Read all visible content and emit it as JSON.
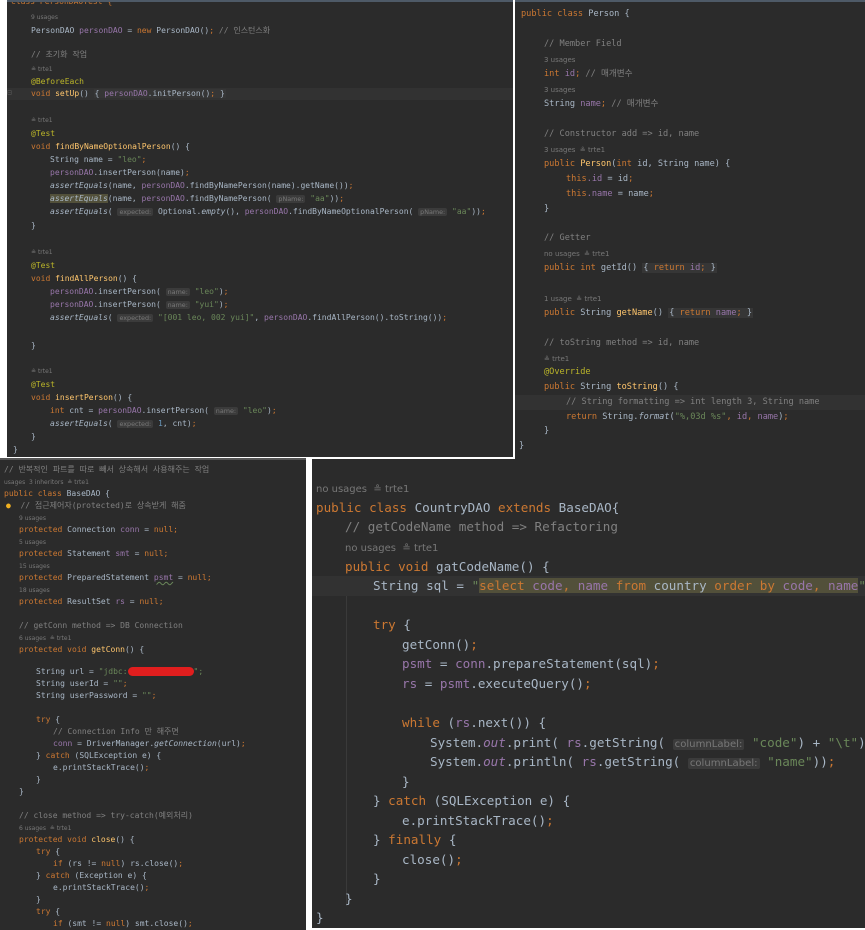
{
  "pane_top_left": {
    "title": "PersonDAOTest",
    "lines": {
      "class_decl": "class PersonDAOTest {",
      "usages_1": "9 usages",
      "field_type": "PersonDAO ",
      "field_name": "personDAO",
      "field_eq": " = ",
      "field_new": "new",
      "field_ctor": " PersonDAO()",
      "field_semi": ";",
      "field_comment": " // 인스턴스화",
      "init_comment": "// 초기화 작업",
      "author": "trte1",
      "before_each": "@BeforeEach",
      "setup_void": "void ",
      "setup_name": "setUp",
      "setup_body_open": "() ",
      "setup_brace_open": "{",
      "setup_field": "personDAO",
      "setup_call": ".initPerson()",
      "setup_semi": ";",
      "setup_brace_close": "}",
      "test_ann": "@Test",
      "m1_name": "findByNameOptionalPerson",
      "m1_l1_type": "String name = ",
      "m1_l1_str": "\"leo\"",
      "m1_l2_call": ".insertPerson(name)",
      "m1_l3_assert": "assertEquals",
      "m1_l3_rest": "(name, ",
      "m1_l3_call": ".findByNamePerson(name).getName())",
      "m1_l4_call": ".findByNamePerson( ",
      "hint_pname": "pName:",
      "str_aa": "\"aa\"",
      "hint_expected": "expected:",
      "m1_l5_optional": " Optional.",
      "m1_l5_empty": "empty",
      "m1_l5_rest": "(), ",
      "m1_l5_call": ".findByNameOptionalPerson( ",
      "m2_name": "findAllPerson",
      "insert_call": ".insertPerson( ",
      "hint_name": "name:",
      "str_leo": "\"leo\"",
      "str_yui": "\"yui\"",
      "m2_expected_str": "\"[001 leo, 002 yui]\"",
      "m2_call": ".findAllPerson().toString())",
      "m3_name": "insertPerson",
      "m3_int": "int",
      "m3_cnt": " cnt = ",
      "m3_one": " 1",
      "m3_rest": ", cnt)",
      "close_brace": "}"
    }
  },
  "pane_top_right": {
    "title": "Person",
    "lines": {
      "class_public": "public class",
      "class_name": " Person {",
      "c_member": "// Member Field",
      "usages3": "3 usages",
      "f_int": "int",
      "f_id": " id",
      "f_comment": " // 매개변수",
      "f_string": "String ",
      "f_name": "name",
      "c_ctor": "// Constructor add => id, name",
      "author": "trte1",
      "ctor_public": "public ",
      "ctor_name": "Person",
      "ctor_params_int": "int",
      "ctor_params": " id, String name) {",
      "this": "this",
      "dot_id": ".id",
      "eq_id": " = id",
      "dot_name": ".name",
      "eq_name": " = name",
      "c_getter": "// Getter",
      "no_usages": "no usages",
      "get_id_sig_public": "public int ",
      "get_id_name": "getId",
      "return_kw": "return",
      "id_word": " id",
      "usage1": "1 usage",
      "get_name_sig": "public ",
      "get_name_type": "String ",
      "get_name_name": "getName",
      "name_word": " name",
      "c_tostring": "// toString method => id, name",
      "override": "@Override",
      "tostring_name": "toString",
      "c_format": "// String formatting => int length 3, String name",
      "format_call": " String.",
      "format_fn": "format",
      "format_str": "\"%,03d %s\"",
      "format_id": "id",
      "format_name": "name",
      "close_brace": "}"
    }
  },
  "pane_bottom_left": {
    "title": "BaseDAO",
    "lines": {
      "c_top": "// 반복적인 파트를 따로 빼서 상속해서 사용해주는 작업",
      "meta_top": "usages  3 inheritors  ≗ trte1",
      "class_decl_kw": "public class",
      "class_decl_name": " BaseDAO {",
      "c_protected": "// 접근제어자(protected)로 상속받게 해줌",
      "u9": "9 usages",
      "protected": "protected",
      "conn_type": " Connection ",
      "conn_name": "conn",
      "null": "null",
      "u5": "5 usages",
      "smt_type": " Statement ",
      "smt_name": "smt",
      "u15": "15 usages",
      "psmt_type": " PreparedStatement ",
      "psmt_name": "psmt",
      "u18": "18 usages",
      "rs_type": " ResultSet ",
      "rs_name": "rs",
      "c_getconn": "// getConn method => DB Connection",
      "u6_author": "6 usages  ≗ trte1",
      "void_kw": " void ",
      "getconn_name": "getConn",
      "url_decl": "String url = ",
      "url_prefix": "\"jdbc:",
      "url_suffix": "\";",
      "userid_decl": "String userId = ",
      "empty_str": "\"\"",
      "userpw_decl": "String userPassword = ",
      "try_kw": "try",
      "c_conn_info": "// Connection Info 만 해주면",
      "conn_assign": " = DriverManager.",
      "get_connection": "getConnection",
      "url_arg": "(url)",
      "catch_kw": "catch",
      "sqlex": " (SQLException e) {",
      "print_stack": "e.printStackTrace()",
      "c_close": "// close method => try-catch(예외처리)",
      "close_name": "close",
      "if_kw": "if",
      "rs_check": " (rs != ",
      "rs_close": ") rs.close()",
      "ex": " (Exception e) {",
      "smt_check": " (smt != ",
      "smt_close": ") smt.close()"
    }
  },
  "pane_bottom_right": {
    "title": "CountryDAO",
    "lines": {
      "meta_class": "no usages",
      "author": "trte1",
      "class_kw": "public class",
      "class_name": " CountryDAO ",
      "extends_kw": "extends",
      "base_name": " BaseDAO{",
      "c_refactor": "// getCodeName method => Refactoring",
      "meta_method": "no usages",
      "method_kw": "public void",
      "method_name": " gatCodeName",
      "method_rest": "() {",
      "sql_decl": "String sql = ",
      "sql_q": "\"",
      "sql_select": "select",
      "sql_code": " code",
      "sql_comma": ",",
      "sql_name": " name",
      "sql_from": " from",
      "sql_country": " country",
      "sql_order": " order by",
      "sql_code2": " code",
      "sql_name2": " name",
      "try_kw": "try",
      "get_conn": "getConn()",
      "psmt": "psmt",
      "psmt_assign": " = ",
      "conn": "conn",
      "prepare": ".prepareStatement(sql)",
      "rs": "rs",
      "execute": ".executeQuery()",
      "while_kw": "while",
      "while_cond_open": " (",
      "while_cond_rest": ".next()) {",
      "system": "System.",
      "out": "out",
      "print": ".print( ",
      "println": ".println( ",
      "get_string": ".getString( ",
      "hint_column": "columnLabel:",
      "str_code": "\"code\"",
      "plus": ") + ",
      "str_tab": "\"\\t\"",
      "str_name": "\"name\"",
      "catch_kw": "catch",
      "sqlex": " (SQLException e) {",
      "print_stack": "e.printStackTrace()",
      "finally_kw": "finally",
      "close_call": "close()",
      "brace_close": "}",
      "brace_open": "{",
      "semi": ";"
    }
  }
}
